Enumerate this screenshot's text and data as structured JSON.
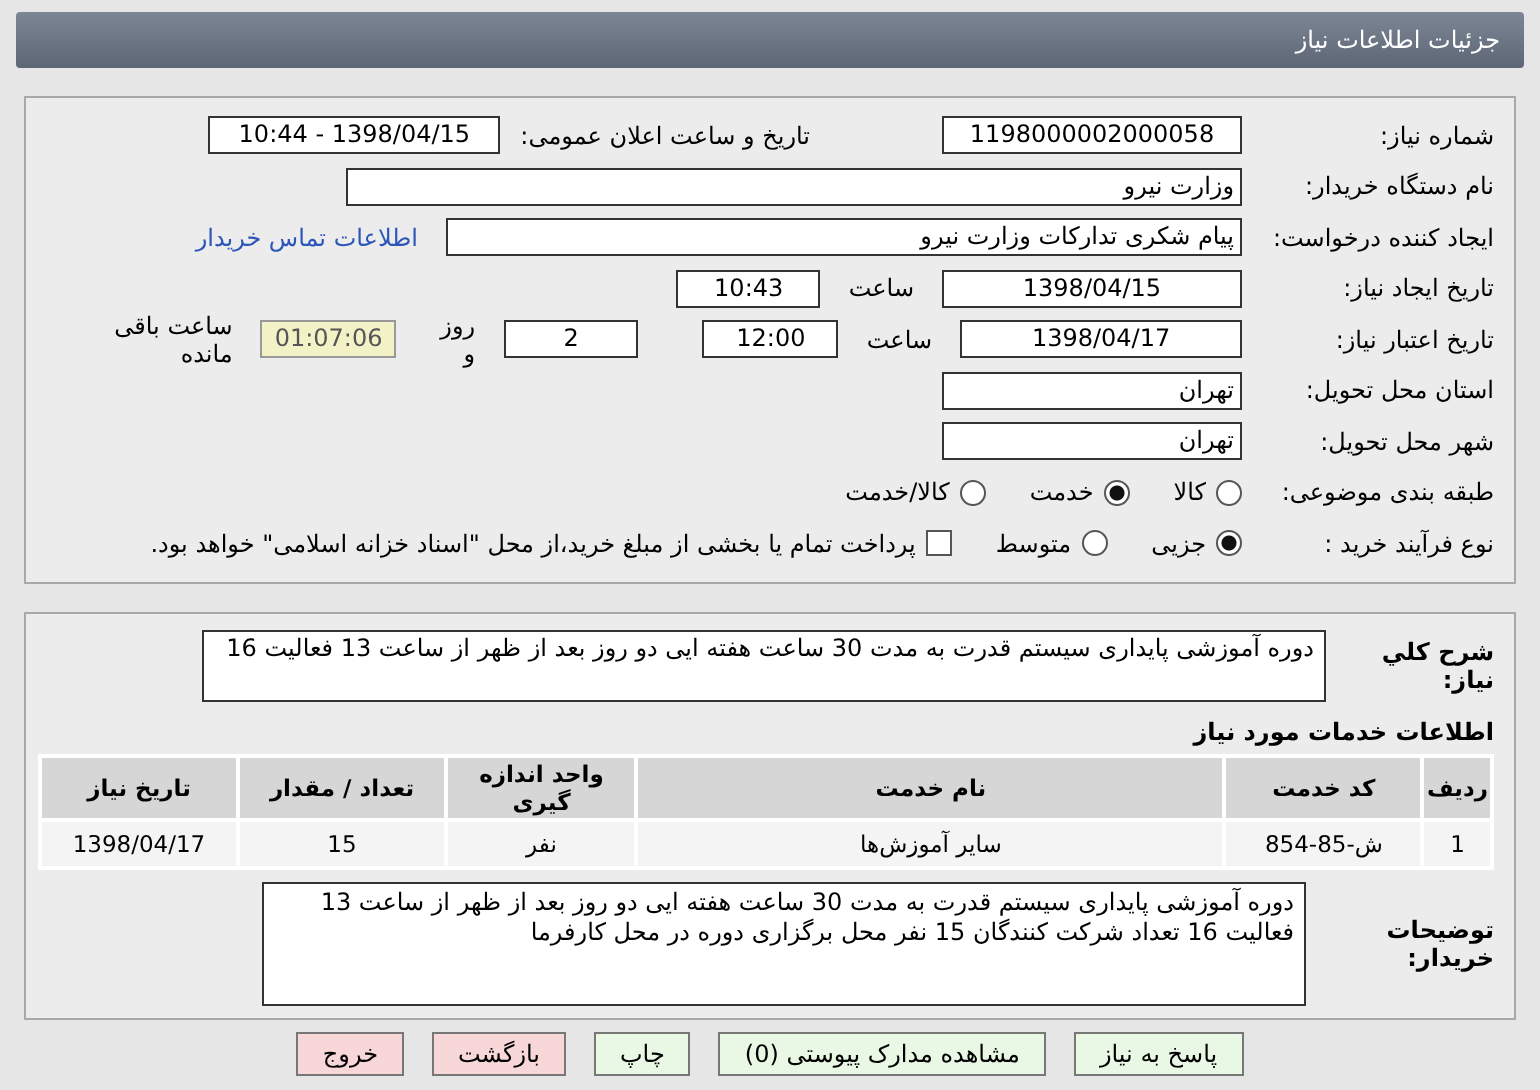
{
  "header": {
    "title": "جزئیات اطلاعات نیاز"
  },
  "details": {
    "need_number": {
      "label": "شماره نیاز:",
      "value": "1198000002000058"
    },
    "announce": {
      "label": "تاریخ و ساعت اعلان عمومی:",
      "value": "1398/04/15 - 10:44"
    },
    "buyer": {
      "label": "نام دستگاه خریدار:",
      "value": "وزارت نیرو"
    },
    "creator": {
      "label": "ایجاد کننده درخواست:",
      "value": "پیام شکری تدارکات وزارت نیرو",
      "link": "اطلاعات تماس خریدار"
    },
    "created": {
      "label": "تاریخ ایجاد نیاز:",
      "date": "1398/04/15",
      "time_label": "ساعت",
      "time": "10:43"
    },
    "valid": {
      "label": "تاریخ اعتبار نیاز:",
      "date": "1398/04/17",
      "time_label": "ساعت",
      "time": "12:00",
      "days": "2",
      "days_label": "روز و",
      "remaining": "01:07:06",
      "remaining_label": "ساعت باقی مانده"
    },
    "province": {
      "label": "استان محل تحویل:",
      "value": "تهران"
    },
    "city": {
      "label": "شهر محل تحویل:",
      "value": "تهران"
    },
    "category": {
      "label": "طبقه بندی موضوعی:",
      "options": [
        {
          "kind": "radio",
          "label": "کالا",
          "selected": false
        },
        {
          "kind": "radio",
          "label": "خدمت",
          "selected": true
        },
        {
          "kind": "radio",
          "label": "کالا/خدمت",
          "selected": false
        }
      ]
    },
    "process": {
      "label": "نوع فرآیند خرید :",
      "options": [
        {
          "kind": "radio",
          "label": "جزیی",
          "selected": true
        },
        {
          "kind": "radio",
          "label": "متوسط",
          "selected": false
        },
        {
          "kind": "checkbox",
          "label": "پرداخت تمام یا بخشی از مبلغ خرید،از محل \"اسناد خزانه اسلامی\" خواهد بود.",
          "checked": false
        }
      ]
    }
  },
  "summary": {
    "label": "شرح كلي نياز:",
    "text": "دوره آموزشی پایداری سیستم قدرت به مدت 30 ساعت هفته ایی دو روز بعد از ظهر از ساعت 13 فعالیت 16"
  },
  "services": {
    "title": "اطلاعات خدمات مورد نیاز",
    "columns": [
      "ردیف",
      "کد خدمت",
      "نام خدمت",
      "واحد اندازه گیری",
      "تعداد / مقدار",
      "تاریخ نیاز"
    ],
    "rows": [
      [
        "1",
        "ش-85-854",
        "سایر آموزش‌ها",
        "نفر",
        "15",
        "1398/04/17"
      ]
    ]
  },
  "remarks": {
    "label": "توضیحات خریدار:",
    "lines": [
      "دوره آموزشی پایداری سیستم قدرت به مدت 30 ساعت هفته ایی دو روز بعد از ظهر از ساعت 13",
      "فعالیت 16 تعداد شرکت کنندگان 15 نفر  محل برگزاری دوره در محل کارفرما"
    ]
  },
  "buttons": [
    {
      "label": "پاسخ به نیاز",
      "kind": "green"
    },
    {
      "label": "مشاهده مدارک پیوستی (0)",
      "kind": "green"
    },
    {
      "label": "چاپ",
      "kind": "green"
    },
    {
      "label": "بازگشت",
      "kind": "red"
    },
    {
      "label": "خروج",
      "kind": "red"
    }
  ]
}
